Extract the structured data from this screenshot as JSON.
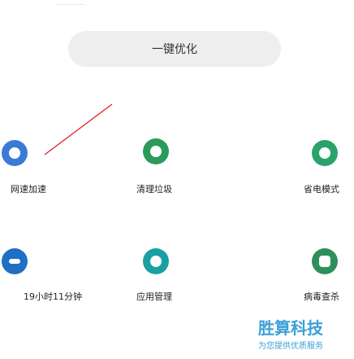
{
  "header": {
    "top_fragment": "..........",
    "one_click_button": "一键优化"
  },
  "tiles": [
    {
      "id": "speed",
      "label": "网速加速",
      "icon": "rocket-icon",
      "color": "#3b7bd8"
    },
    {
      "id": "clean",
      "label": "清理垃圾",
      "icon": "broom-icon",
      "color": "#2a9b5a"
    },
    {
      "id": "battery",
      "label": "省电模式",
      "icon": "leaf-icon",
      "color": "#2aa36b"
    },
    {
      "id": "status",
      "label": "19小时11分钟",
      "icon": "clock-icon",
      "color": "#1f6fc4"
    },
    {
      "id": "apps",
      "label": "应用管理",
      "icon": "grid-icon",
      "color": "#1aa0a0"
    },
    {
      "id": "security",
      "label": "病毒查杀",
      "icon": "shield-icon",
      "color": "#2f8f5a"
    }
  ],
  "watermark": {
    "title": "胜算科技",
    "subtitle": "为您提供优质服务"
  },
  "colors": {
    "sweep_line": "#e0242a",
    "button_bg": "#eeeeee"
  }
}
